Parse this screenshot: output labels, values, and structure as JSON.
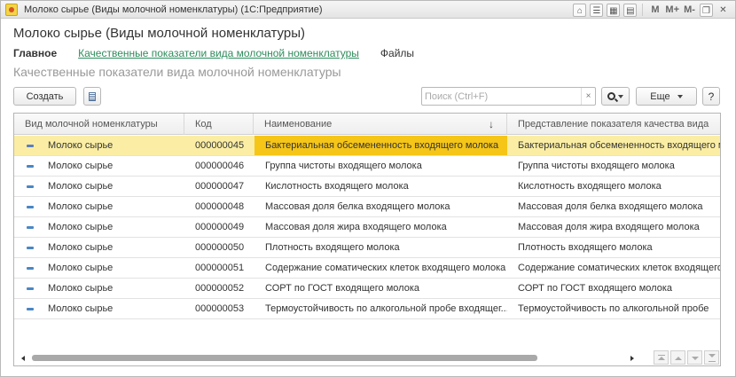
{
  "window": {
    "title": "Молоко сырье (Виды молочной номенклатуры)  (1С:Предприятие)",
    "toolbar": [
      "home-icon",
      "history-icon",
      "calendar-icon",
      "calculator-icon",
      "M",
      "M+",
      "M-",
      "restore-icon",
      "close-icon"
    ],
    "m_label": "M",
    "mplus_label": "M+",
    "mminus_label": "M-"
  },
  "form": {
    "title": "Молоко сырье (Виды молочной номенклатуры)",
    "nav": {
      "main": "Главное",
      "quality_link": "Качественные показатели вида молочной номенклатуры",
      "files": "Файлы"
    },
    "section_title": "Качественные показатели вида молочной номенклатуры"
  },
  "commands": {
    "create": "Создать",
    "search_placeholder": "Поиск (Ctrl+F)",
    "search_value": "",
    "clear": "×",
    "more": "Еще",
    "help": "?"
  },
  "table": {
    "columns": [
      "Вид молочной номенклатуры",
      "Код",
      "Наименование",
      "Представление показателя качества вида"
    ],
    "sort_indicator": "↓",
    "selected_row": 0,
    "rows": [
      {
        "kind": "Молоко сырье",
        "code": "000000045",
        "name": "Бактериальная обсемененность входящего молока",
        "repr": "Бактериальная обсемененность входящего молока"
      },
      {
        "kind": "Молоко сырье",
        "code": "000000046",
        "name": "Группа чистоты входящего молока",
        "repr": "Группа чистоты входящего молока"
      },
      {
        "kind": "Молоко сырье",
        "code": "000000047",
        "name": "Кислотность входящего молока",
        "repr": "Кислотность входящего молока"
      },
      {
        "kind": "Молоко сырье",
        "code": "000000048",
        "name": "Массовая доля белка входящего молока",
        "repr": "Массовая доля белка входящего молока"
      },
      {
        "kind": "Молоко сырье",
        "code": "000000049",
        "name": "Массовая доля жира входящего молока",
        "repr": "Массовая доля жира входящего молока"
      },
      {
        "kind": "Молоко сырье",
        "code": "000000050",
        "name": "Плотность входящего молока",
        "repr": "Плотность входящего молока"
      },
      {
        "kind": "Молоко сырье",
        "code": "000000051",
        "name": "Содержание соматических клеток входящего молока",
        "repr": "Содержание соматических клеток входящего молока"
      },
      {
        "kind": "Молоко сырье",
        "code": "000000052",
        "name": "СОРТ по ГОСТ входящего молока",
        "repr": "СОРТ по ГОСТ входящего молока"
      },
      {
        "kind": "Молоко сырье",
        "code": "000000053",
        "name": "Термоустойчивость по алкогольной пробе входящег...",
        "repr": "Термоустойчивость по алкогольной пробе"
      }
    ]
  },
  "colors": {
    "link": "#2e8c5c",
    "selected_row": "#fbeea4",
    "selected_cell": "#f5c518"
  }
}
